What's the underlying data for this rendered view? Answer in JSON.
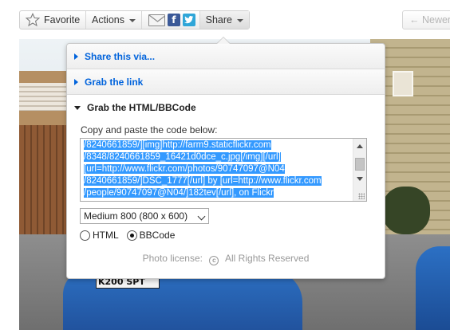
{
  "toolbar": {
    "favorite_label": "Favorite",
    "actions_label": "Actions",
    "share_label": "Share",
    "newer_label": "← Newer",
    "facebook_letter": "f",
    "twitter_letter": "t",
    "icons": [
      "star-icon",
      "mail-icon",
      "facebook-icon",
      "twitter-icon",
      "caret-down-icon"
    ]
  },
  "photo": {
    "plate_text": "K200 SPT"
  },
  "share_panel": {
    "sections": [
      {
        "label": "Share this via...",
        "expanded": false
      },
      {
        "label": "Grab the link",
        "expanded": false
      },
      {
        "label": "Grab the HTML/BBCode",
        "expanded": true
      }
    ],
    "copy_label": "Copy and paste the code below:",
    "code_lines": [
      "/8240661859/][img]http://farm9.staticflickr.com",
      "/8348/8240661859_16421d0dce_c.jpg[/img][/url]",
      "[url=http://www.flickr.com/photos/90747097@N04",
      "/8240661859/]DSC_1777[/url] by [url=http://www.flickr.com",
      "/people/90747097@N04/]182tev[/url], on Flickr"
    ],
    "size_select": "Medium 800 (800 x 600)",
    "format_options": [
      {
        "label": "HTML",
        "selected": false
      },
      {
        "label": "BBCode",
        "selected": true
      }
    ],
    "license_prefix": "Photo license:",
    "license_symbol": "c",
    "license_text": "All Rights Reserved"
  },
  "colors": {
    "link_blue": "#0063dc",
    "selection_blue": "#3399ff"
  }
}
